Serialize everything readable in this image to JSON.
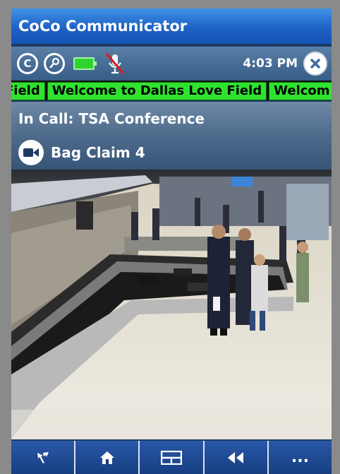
{
  "app": {
    "title": "CoCo Communicator"
  },
  "status": {
    "time": "4:03 PM",
    "icons": [
      "coco-logo-icon",
      "key-icon",
      "battery-icon",
      "mic-muted-icon",
      "close-icon"
    ],
    "logo_glyph": "C",
    "battery_color": "#31d331"
  },
  "ticker": {
    "items": [
      "Field",
      "Welcome to Dallas Love Field",
      "Welcom"
    ],
    "color": "#30e230"
  },
  "call": {
    "text": "In Call: TSA Conference"
  },
  "camera": {
    "label": "Bag Claim 4",
    "icon": "video-camera-icon"
  },
  "toolbar": {
    "buttons": [
      {
        "name": "pointer-button",
        "icon": "pointer-icon"
      },
      {
        "name": "home-button",
        "icon": "home-icon"
      },
      {
        "name": "layout-button",
        "icon": "layout-icon"
      },
      {
        "name": "rewind-button",
        "icon": "rewind-icon"
      },
      {
        "name": "more-button",
        "label": "...",
        "icon": "ellipsis-icon"
      }
    ]
  }
}
